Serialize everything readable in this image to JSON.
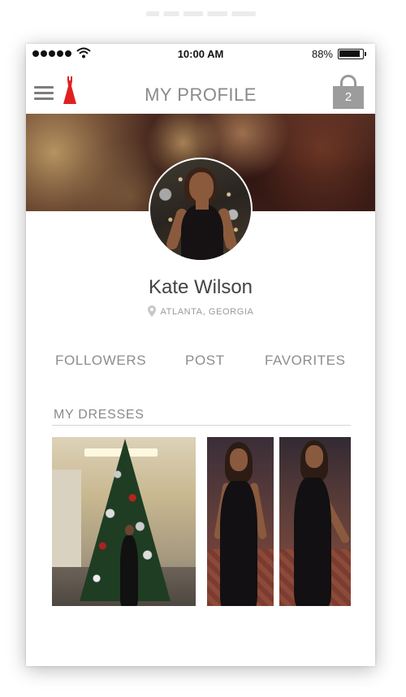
{
  "status_bar": {
    "time": "10:00 AM",
    "battery": "88%",
    "icons": [
      "signal-icon",
      "wifi-icon",
      "battery-icon"
    ]
  },
  "nav": {
    "title": "MY PROFILE",
    "cart_count": "2",
    "icons": [
      "menu-icon",
      "dress-logo-icon",
      "shopping-bag-icon"
    ]
  },
  "profile": {
    "name": "Kate Wilson",
    "location": "ATLANTA, GEORGIA"
  },
  "stats": {
    "followers": "FOLLOWERS",
    "post": "POST",
    "favorites": "FAVORITES"
  },
  "dresses": {
    "section_title": "MY DRESSES"
  },
  "colors": {
    "accent_red": "#e02020",
    "text_gray": "#8a8a8a"
  }
}
